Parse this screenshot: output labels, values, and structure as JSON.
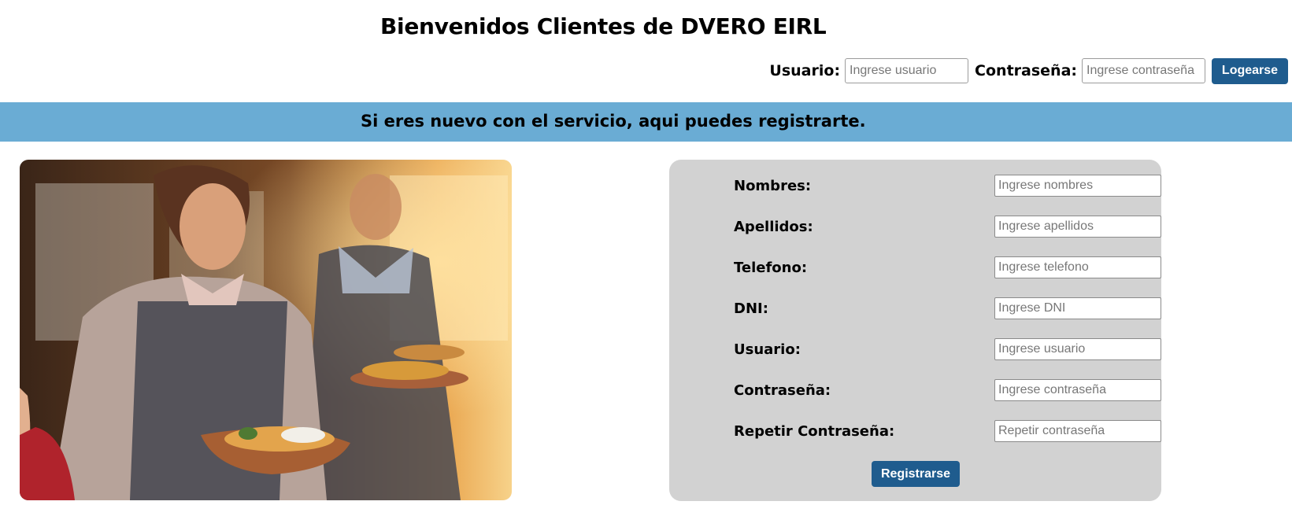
{
  "header": {
    "title": "Bienvenidos Clientes de DVERO EIRL"
  },
  "login": {
    "user_label": "Usuario:",
    "user_placeholder": "Ingrese usuario",
    "password_label": "Contraseña:",
    "password_placeholder": "Ingrese contraseña",
    "submit_label": "Logearse"
  },
  "banner": {
    "text": "Si eres nuevo con el servicio, aqui puedes registrarte."
  },
  "register": {
    "fields": [
      {
        "label": "Nombres:",
        "placeholder": "Ingrese nombres"
      },
      {
        "label": "Apellidos:",
        "placeholder": "Ingrese apellidos"
      },
      {
        "label": "Telefono:",
        "placeholder": "Ingrese telefono"
      },
      {
        "label": "DNI:",
        "placeholder": "Ingrese DNI"
      },
      {
        "label": "Usuario:",
        "placeholder": "Ingrese usuario"
      },
      {
        "label": "Contraseña:",
        "placeholder": "Ingrese contraseña"
      },
      {
        "label": "Repetir Contraseña:",
        "placeholder": "Repetir contraseña"
      }
    ],
    "submit_label": "Registrarse"
  },
  "colors": {
    "banner": "#6aacd4",
    "button": "#1f5c8e",
    "card": "#d2d2d2"
  }
}
